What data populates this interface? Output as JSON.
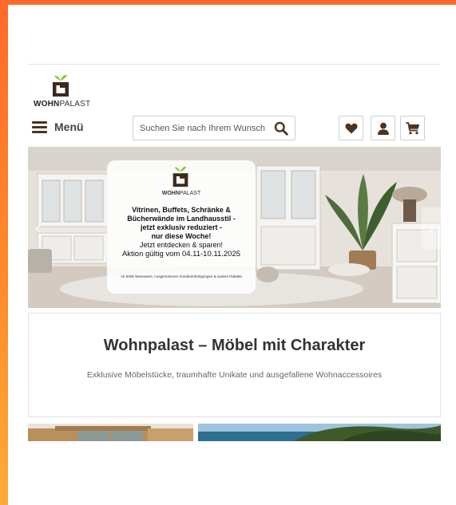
{
  "logo": {
    "brand_bold": "WOHN",
    "brand_light": "PALAST"
  },
  "header": {
    "menu_label": "Menü",
    "search_placeholder": "Suchen Sie nach Ihrem Wunsch"
  },
  "icons": {
    "menu": "hamburger-icon",
    "search": "search-icon",
    "wishlist": "heart-icon",
    "account": "user-icon",
    "cart": "cart-icon",
    "prev": "chevron-left-icon",
    "next": "chevron-right-icon"
  },
  "colors": {
    "accent": "#4a3422",
    "frame": "#ff7a2a",
    "leaf": "#8cc63f",
    "text": "#333333"
  },
  "hero": {
    "brand_bold": "WOHN",
    "brand_light": "PALAST",
    "line1": "Vitrinen, Buffets, Schränke &",
    "line2": "Bücherwände im Landhausstil -",
    "line3": "jetzt exklusiv reduziert -",
    "line4": "nur diese Woche!",
    "line5": "Jetzt entdecken & sparen!",
    "line6": "Aktion gültig vom 04.11-10.11.2025",
    "fineprint": "Ab 500€ Warenwert, Ausgenommen Sonderanfertigungen & andere Rabatte",
    "prev_symbol": "‹",
    "next_symbol": "›"
  },
  "intro": {
    "title": "Wohnpalast – Möbel mit Charakter",
    "subtitle": "Exklusive Möbelstücke, traumhafte Unikate und ausgefallene Wohnaccessoires"
  }
}
